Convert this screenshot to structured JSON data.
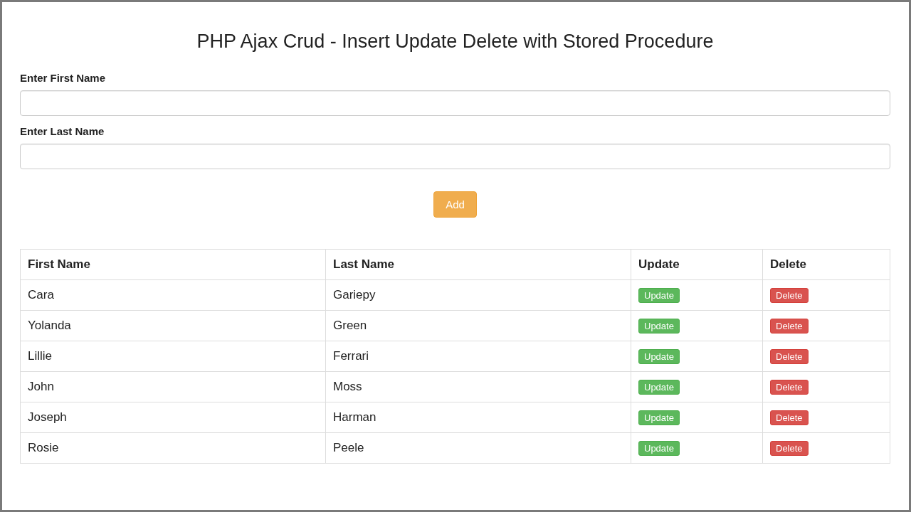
{
  "title": "PHP Ajax Crud - Insert Update Delete with Stored Procedure",
  "form": {
    "fields": [
      {
        "label": "Enter First Name"
      },
      {
        "label": "Enter Last Name"
      }
    ],
    "button": "Add"
  },
  "table": {
    "columns": [
      "First Name",
      "Last Name",
      "Update",
      "Delete"
    ],
    "rows": [
      {
        "first": "Cara",
        "last": "Gariepy",
        "update": "Update",
        "delete": "Delete"
      },
      {
        "first": "Yolanda",
        "last": "Green",
        "update": "Update",
        "delete": "Delete"
      },
      {
        "first": "Lillie",
        "last": "Ferrari",
        "update": "Update",
        "delete": "Delete"
      },
      {
        "first": "John",
        "last": "Moss",
        "update": "Update",
        "delete": "Delete"
      },
      {
        "first": "Joseph",
        "last": "Harman",
        "update": "Update",
        "delete": "Delete"
      },
      {
        "first": "Rosie",
        "last": "Peele",
        "update": "Update",
        "delete": "Delete"
      }
    ]
  }
}
